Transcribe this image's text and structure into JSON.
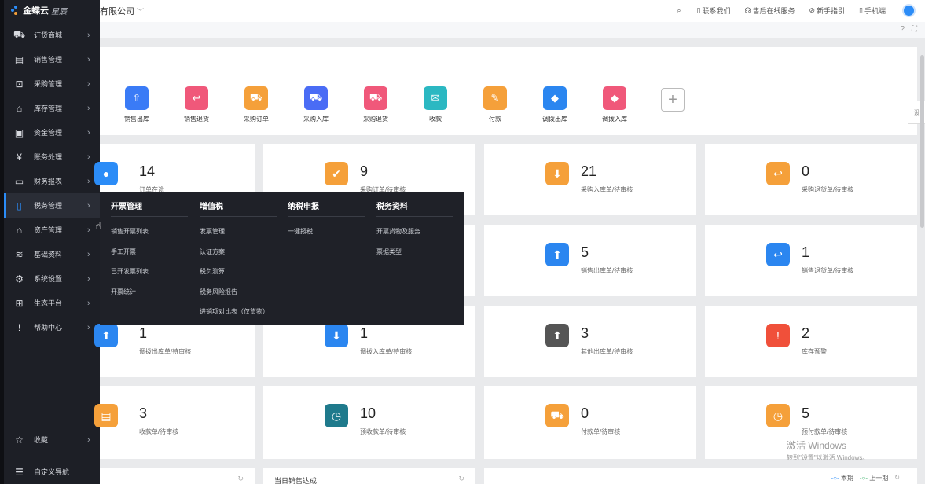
{
  "app": {
    "logo_main": "金蝶云",
    "logo_sub": "星辰",
    "company": "有限公司"
  },
  "top_links": [
    {
      "icon": "search-icon",
      "label": ""
    },
    {
      "icon": "contact-icon",
      "label": "联系我们"
    },
    {
      "icon": "headset-icon",
      "label": "售后在线服务"
    },
    {
      "icon": "compass-icon",
      "label": "新手指引"
    },
    {
      "icon": "phone-icon",
      "label": "手机端"
    }
  ],
  "sidebar": {
    "items": [
      {
        "icon": "cart-icon",
        "label": "订货商城"
      },
      {
        "icon": "chart-icon",
        "label": "销售管理"
      },
      {
        "icon": "bag-icon",
        "label": "采购管理"
      },
      {
        "icon": "warehouse-icon",
        "label": "库存管理"
      },
      {
        "icon": "fund-icon",
        "label": "资金管理"
      },
      {
        "icon": "yen-icon",
        "label": "账务处理"
      },
      {
        "icon": "report-icon",
        "label": "财务报表"
      },
      {
        "icon": "tax-icon",
        "label": "税务管理"
      },
      {
        "icon": "asset-icon",
        "label": "资产管理"
      },
      {
        "icon": "layers-icon",
        "label": "基础资料"
      },
      {
        "icon": "gear-icon",
        "label": "系统设置"
      },
      {
        "icon": "grid-icon",
        "label": "生态平台"
      },
      {
        "icon": "help-icon",
        "label": "帮助中心"
      }
    ],
    "bottom": [
      {
        "icon": "star-icon",
        "label": "收藏"
      },
      {
        "icon": "custom-nav-icon",
        "label": "自定义导航"
      }
    ]
  },
  "quick_actions": [
    {
      "label": "销售出库",
      "color": "#3a7bf6",
      "icon": "house-up-icon"
    },
    {
      "label": "销售退货",
      "color": "#f0587a",
      "icon": "return-icon"
    },
    {
      "label": "采购订单",
      "color": "#f5a03a",
      "icon": "cart-icon"
    },
    {
      "label": "采购入库",
      "color": "#4a6cf5",
      "icon": "cart-in-icon"
    },
    {
      "label": "采购退货",
      "color": "#f0587a",
      "icon": "cart-return-icon"
    },
    {
      "label": "收款",
      "color": "#2bb8c2",
      "icon": "receive-icon"
    },
    {
      "label": "付款",
      "color": "#f5a03a",
      "icon": "pay-icon"
    },
    {
      "label": "调拨出库",
      "color": "#2b86f0",
      "icon": "transfer-out-icon"
    },
    {
      "label": "调拨入库",
      "color": "#f0587a",
      "icon": "transfer-in-icon"
    }
  ],
  "cards": [
    {
      "value": "14",
      "label": "订单在途",
      "color": "#2b8cf7",
      "icon": "order-icon"
    },
    {
      "value": "9",
      "label": "采购订单/待审核",
      "color": "#f5a03a",
      "icon": "doc-check-icon"
    },
    {
      "value": "21",
      "label": "采购入库单/待审核",
      "color": "#f5a03a",
      "icon": "bag-down-icon"
    },
    {
      "value": "0",
      "label": "采购退货单/待审核",
      "color": "#f5a03a",
      "icon": "return-arrow-icon"
    },
    {
      "value": "",
      "label": "",
      "color": "#2b8cf7",
      "icon": ""
    },
    {
      "value": "",
      "label": "",
      "color": "#2b8cf7",
      "icon": ""
    },
    {
      "value": "5",
      "label": "销售出库单/待审核",
      "color": "#2b86f0",
      "icon": "box-up-icon"
    },
    {
      "value": "1",
      "label": "销售退货单/待审核",
      "color": "#2b86f0",
      "icon": "return-arrow-icon"
    },
    {
      "value": "1",
      "label": "调拨出库单/待审核",
      "color": "#2b86f0",
      "icon": "diamond-up-icon"
    },
    {
      "value": "1",
      "label": "调拨入库单/待审核",
      "color": "#2b86f0",
      "icon": "diamond-down-icon"
    },
    {
      "value": "3",
      "label": "其他出库单/待审核",
      "color": "#555555",
      "icon": "hex-up-icon"
    },
    {
      "value": "2",
      "label": "库存预警",
      "color": "#f0503a",
      "icon": "house-alert-icon"
    },
    {
      "value": "3",
      "label": "收款单/待审核",
      "color": "#f5a03a",
      "icon": "receipt-icon"
    },
    {
      "value": "10",
      "label": "预收款单/待审核",
      "color": "#1f7a8c",
      "icon": "prepay-icon"
    },
    {
      "value": "0",
      "label": "付款单/待审核",
      "color": "#f5a03a",
      "icon": "cart-pay-icon"
    },
    {
      "value": "5",
      "label": "预付款单/待审核",
      "color": "#f5a03a",
      "icon": "prepay-out-icon"
    }
  ],
  "bottom_tiles": [
    {
      "title": ""
    },
    {
      "title": "当日销售达成"
    },
    {
      "legend_current": "本期",
      "legend_previous": "上一期"
    }
  ],
  "flyout": {
    "columns": [
      {
        "title": "开票管理",
        "links": [
          "销售开票列表",
          "手工开票",
          "已开发票列表",
          "开票统计"
        ]
      },
      {
        "title": "增值税",
        "links": [
          "发票管理",
          "认证方案",
          "税负测算",
          "税务风险报告",
          "进销项对比表（仅货物）"
        ]
      },
      {
        "title": "纳税申报",
        "links": [
          "一键报税"
        ]
      },
      {
        "title": "税务资料",
        "links": [
          "开票货物及服务",
          "票据类型"
        ]
      }
    ]
  },
  "right_tab": "设",
  "watermark": {
    "line1": "激活 Windows",
    "line2": "转到\"设置\"以激活 Windows。"
  }
}
